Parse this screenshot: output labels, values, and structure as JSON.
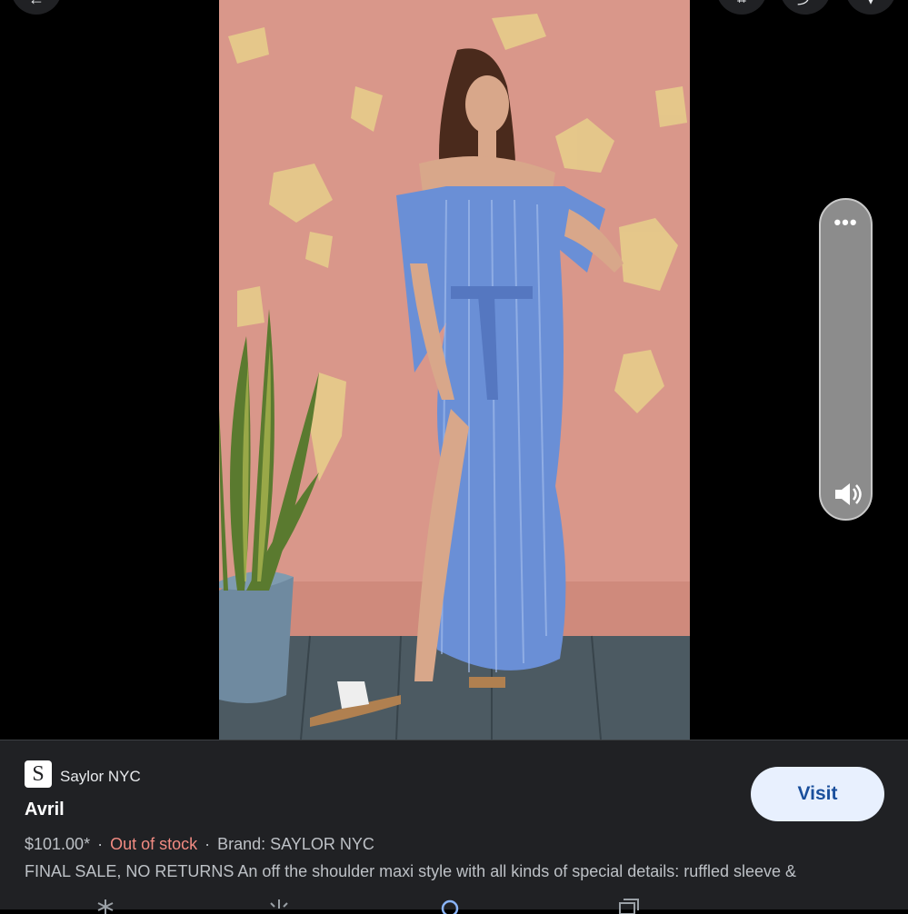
{
  "top_buttons": [
    {
      "name": "back",
      "icon": "arrow-left-icon"
    },
    {
      "name": "lens",
      "icon": "lens-icon"
    },
    {
      "name": "share",
      "icon": "share-icon"
    },
    {
      "name": "save",
      "icon": "bookmark-icon"
    }
  ],
  "volume_overlay": {
    "menu_label": "•••",
    "icon": "speaker-icon"
  },
  "product": {
    "merchant_logo_letter": "S",
    "merchant": "Saylor NYC",
    "title": "Avril",
    "price": "$101.00*",
    "separator": "·",
    "stock_status": "Out of stock",
    "brand": "Brand: SAYLOR NYC",
    "description": "FINAL SALE, NO RETURNS An off the shoulder maxi style with all kinds of special details: ruffled sleeve &",
    "visit_label": "Visit"
  },
  "colors": {
    "card_bg": "#202124",
    "stock_red": "#f28b82",
    "visit_bg": "#e8f0fe",
    "visit_text": "#1a4f9c"
  }
}
